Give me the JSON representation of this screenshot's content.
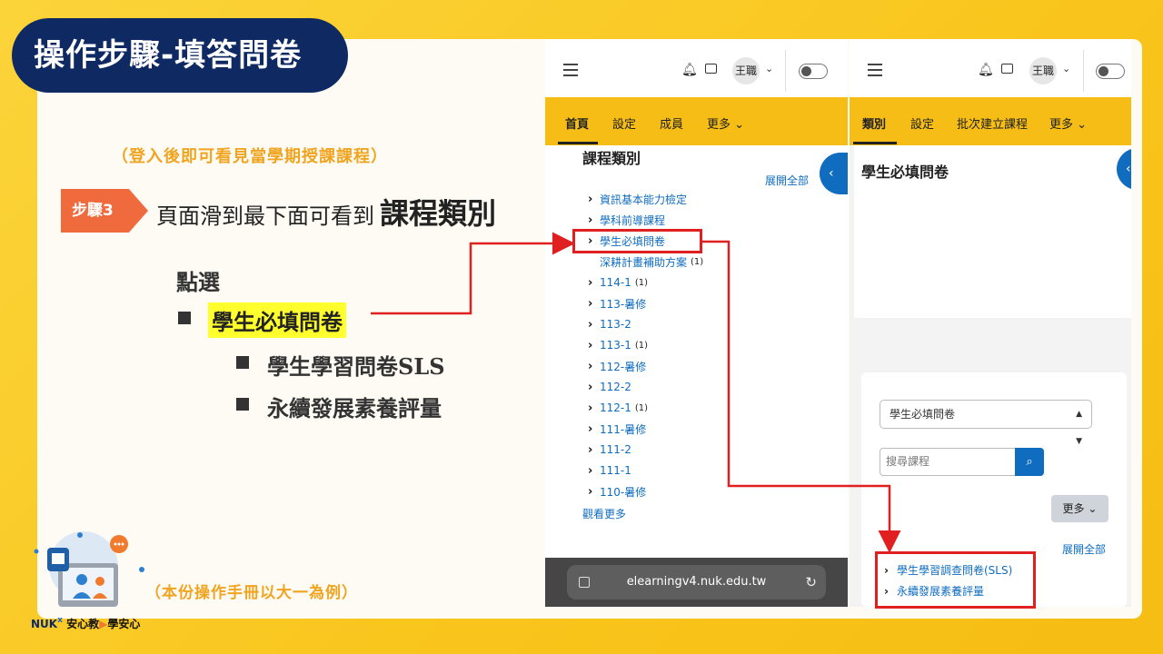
{
  "slide": {
    "title": "操作步驟-填答問卷",
    "sub_note": "（登入後即可看見當學期授課課程）",
    "step_tag": "步驟3",
    "step_text": "頁面滑到最下面可看到",
    "step_emph": "課程類別",
    "click_label": "點選",
    "highlight_item": "學生必填問卷",
    "sub_items": [
      "學生學習問卷SLS",
      "永續發展素養評量"
    ],
    "bottom_note": "（本份操作手冊以大一為例）",
    "logo_brand": "NUK",
    "logo_x": "x",
    "logo_slogan": "安心教",
    "logo_play": "▶",
    "logo_slogan2": "學安心"
  },
  "pane1": {
    "user": "王職",
    "nav": [
      "首頁",
      "設定",
      "成員",
      "更多"
    ],
    "section_title": "課程類別",
    "expand_all": "展開全部",
    "tree": [
      {
        "label": "資訊基本能力檢定",
        "count": "",
        "arrow": true
      },
      {
        "label": "學科前導課程",
        "count": "",
        "arrow": true
      },
      {
        "label": "學生必填問卷",
        "count": "",
        "arrow": true
      },
      {
        "label": "深耕計畫補助方案",
        "count": "(1)",
        "arrow": false
      },
      {
        "label": "114-1",
        "count": "(1)",
        "arrow": true
      },
      {
        "label": "113-暑修",
        "count": "",
        "arrow": true
      },
      {
        "label": "113-2",
        "count": "",
        "arrow": true
      },
      {
        "label": "113-1",
        "count": "(1)",
        "arrow": true
      },
      {
        "label": "112-暑修",
        "count": "",
        "arrow": true
      },
      {
        "label": "112-2",
        "count": "",
        "arrow": true
      },
      {
        "label": "112-1",
        "count": "(1)",
        "arrow": true
      },
      {
        "label": "111-暑修",
        "count": "",
        "arrow": true
      },
      {
        "label": "111-2",
        "count": "",
        "arrow": true
      },
      {
        "label": "111-1",
        "count": "",
        "arrow": true
      },
      {
        "label": "110-暑修",
        "count": "",
        "arrow": true
      }
    ],
    "view_more": "觀看更多",
    "url": "elearningv4.nuk.edu.tw"
  },
  "pane2": {
    "user": "王職",
    "nav": [
      "類別",
      "設定",
      "批次建立課程",
      "更多"
    ],
    "heading": "學生必填問卷",
    "select_value": "學生必填問卷",
    "search_placeholder": "搜尋課程",
    "more_button": "更多",
    "expand_all": "展開全部",
    "courses": [
      "學生學習調查問卷(SLS)",
      "永續發展素養評量"
    ]
  }
}
